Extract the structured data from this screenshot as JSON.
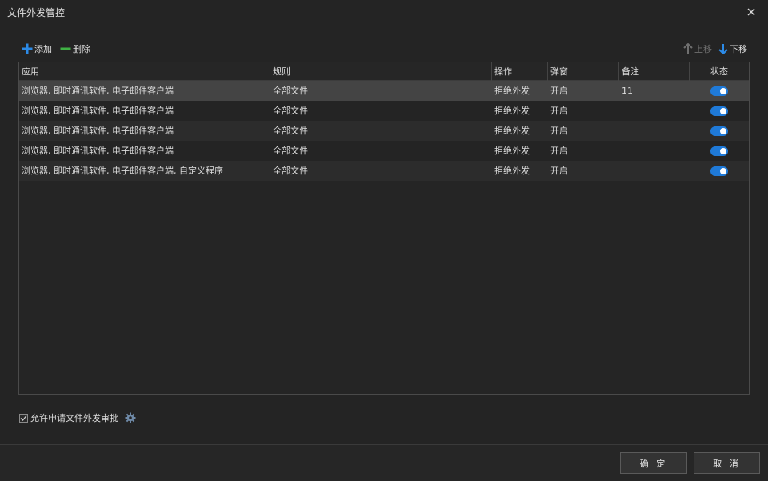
{
  "window": {
    "title": "文件外发管控"
  },
  "toolbar": {
    "add_label": "添加",
    "delete_label": "删除",
    "move_up_label": "上移",
    "move_down_label": "下移"
  },
  "table": {
    "columns": [
      "应用",
      "规则",
      "操作",
      "弹窗",
      "备注",
      "状态"
    ],
    "rows": [
      {
        "app": "浏览器, 即时通讯软件, 电子邮件客户端",
        "rule": "全部文件",
        "action": "拒绝外发",
        "popup": "开启",
        "note": "11",
        "enabled": true
      },
      {
        "app": "浏览器, 即时通讯软件, 电子邮件客户端",
        "rule": "全部文件",
        "action": "拒绝外发",
        "popup": "开启",
        "note": "",
        "enabled": true
      },
      {
        "app": "浏览器, 即时通讯软件, 电子邮件客户端",
        "rule": "全部文件",
        "action": "拒绝外发",
        "popup": "开启",
        "note": "",
        "enabled": true
      },
      {
        "app": "浏览器, 即时通讯软件, 电子邮件客户端",
        "rule": "全部文件",
        "action": "拒绝外发",
        "popup": "开启",
        "note": "",
        "enabled": true
      },
      {
        "app": "浏览器, 即时通讯软件, 电子邮件客户端, 自定义程序",
        "rule": "全部文件",
        "action": "拒绝外发",
        "popup": "开启",
        "note": "",
        "enabled": true
      }
    ],
    "selected_row": 0
  },
  "approval": {
    "label": "允许申请文件外发审批",
    "checked": true
  },
  "footer": {
    "ok_label": "确 定",
    "cancel_label": "取 消"
  },
  "colors": {
    "accent_blue": "#1f7ad8",
    "add_icon": "#2c8be8",
    "delete_icon": "#3fb244",
    "background": "#242424"
  },
  "icons": {
    "close": "close-icon",
    "add": "plus-icon",
    "delete": "minus-icon",
    "up": "arrow-up-icon",
    "down": "arrow-down-icon",
    "settings": "gear-icon",
    "check": "check-icon"
  }
}
